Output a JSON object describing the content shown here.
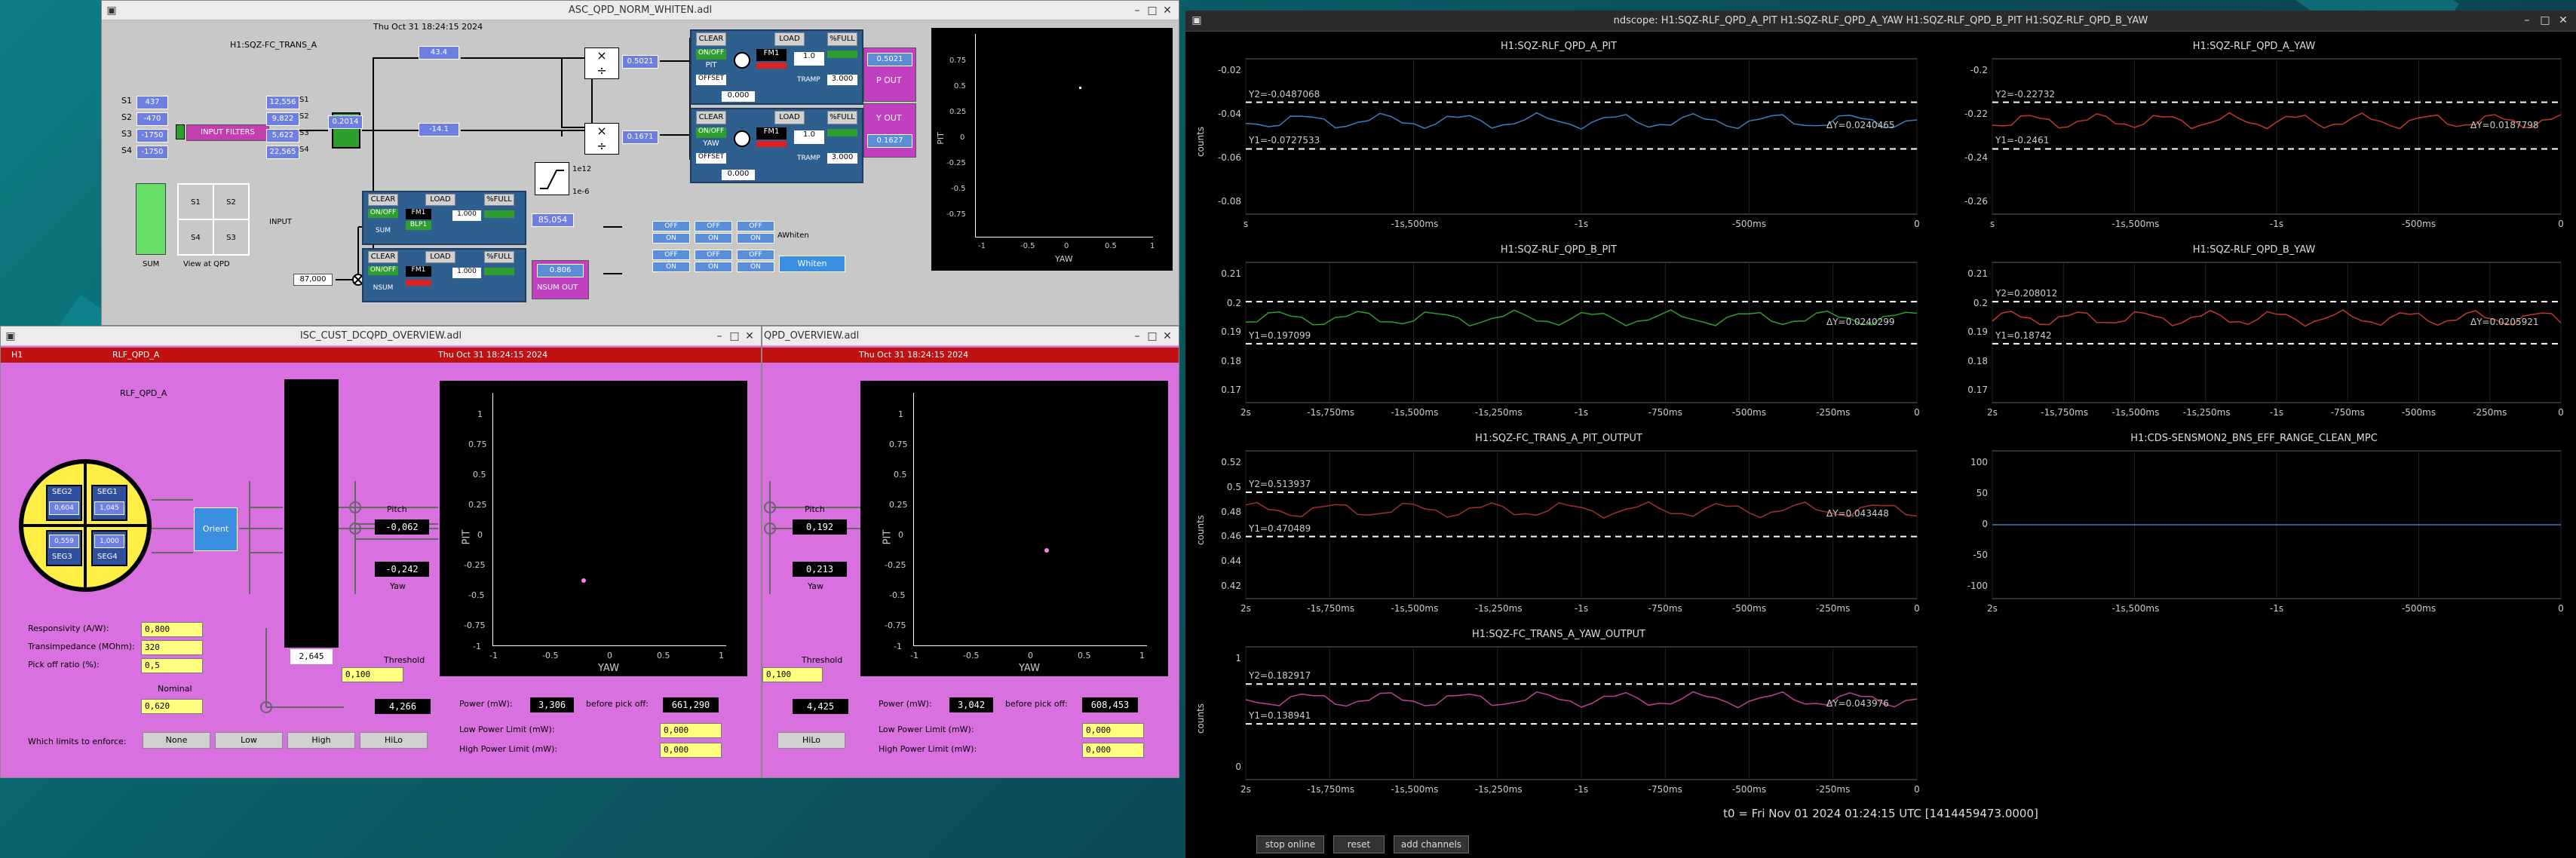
{
  "whiten_window": {
    "title": "ASC_QPD_NORM_WHITEN.adl",
    "channel": "H1:SQZ-FC_TRANS_A",
    "timestamp": "Thu Oct 31 18:24:15 2024",
    "segments": [
      "S1",
      "S2",
      "S3",
      "S4"
    ],
    "seg_values": [
      "437",
      "-470",
      "-1750",
      "-1750"
    ],
    "seg_out_values": [
      "12,556",
      "9,822",
      "5,622",
      "22,565"
    ],
    "input_filters": "INPUT FILTERS",
    "sum_value": "0.2014",
    "sum_label": "SUM",
    "view_label": "View at QPD",
    "quad_labels": [
      "S1",
      "S2",
      "S4",
      "S3"
    ],
    "input_label": "INPUT",
    "top_val": "43.4",
    "mid_val": "-14.1",
    "p_mult_val": "0.5021",
    "y_mult_val": "0.1671",
    "limit_a": "1e12",
    "limit_b": "1e-6",
    "pit_bank": {
      "clear": "CLEAR",
      "load": "LOAD",
      "full": "%FULL",
      "onoff": "ON/OFF",
      "name": "PIT",
      "fm1": "FM1",
      "offset": "OFFSET",
      "gain": "1.0",
      "offv": "0.000",
      "tramp": "TRAMP",
      "tramp_val": "3.000",
      "out_label": "P OUT",
      "out_val": "0.5021"
    },
    "yaw_bank": {
      "clear": "CLEAR",
      "load": "LOAD",
      "full": "%FULL",
      "onoff": "ON/OFF",
      "name": "YAW",
      "fm1": "FM1",
      "offset": "OFFSET",
      "gain": "1.0",
      "offv": "0.000",
      "tramp": "TRAMP",
      "tramp_val": "3.000",
      "out_label": "Y OUT",
      "out_val": "0.1627"
    },
    "sum_bank": {
      "clear": "CLEAR",
      "load": "LOAD",
      "full": "%FULL",
      "onoff": "ON/OFF",
      "name": "SUM",
      "fm1": "FM1",
      "val": "1.000",
      "filt": "BLP1",
      "out": "85,054"
    },
    "nsum_bank": {
      "clear": "CLEAR",
      "load": "LOAD",
      "full": "%FULL",
      "onoff": "ON/OFF",
      "name": "NSUM",
      "fm1": "FM1",
      "val": "1.000",
      "out": "0.806",
      "out_label": "NSUM OUT"
    },
    "nsum_in": "87,000",
    "whiten_label": "AWhiten",
    "whiten_btn": "Whiten",
    "off_labels": [
      "OFF",
      "OFF",
      "OFF",
      "OFF",
      "OFF",
      "OFF"
    ],
    "on_labels": [
      "ON",
      "ON",
      "ON",
      "ON",
      "ON",
      "ON"
    ],
    "scope": {
      "ylabel": "PIT",
      "xlabel": "YAW",
      "yticks": [
        "0.75",
        "0.5",
        "0.25",
        "0",
        "-0.25",
        "-0.5",
        "-0.75"
      ],
      "xticks": [
        "-1",
        "-0.5",
        "0",
        "0.5",
        "1"
      ]
    }
  },
  "overview_window": {
    "title": "ISC_CUST_DCQPD_OVERVIEW.adl",
    "header_left": "H1",
    "header_mid": "RLF_QPD_A",
    "timestamp": "Thu Oct 31 18:24:15 2024",
    "name": "RLF_QPD_A",
    "segs": [
      {
        "name": "SEG2",
        "val": "0,604"
      },
      {
        "name": "SEG1",
        "val": "1,045"
      },
      {
        "name": "SEG3",
        "val": "0,559"
      },
      {
        "name": "SEG4",
        "val": "1,000"
      }
    ],
    "seg_bottom": [
      "SEG3",
      "SEG4"
    ],
    "orient": "Orient",
    "bar_val": "2,645",
    "pitch_label": "Pitch",
    "pitch_val": "-0,062",
    "yaw_label": "Yaw",
    "yaw_val": "-0,242",
    "threshold_label": "Threshold",
    "threshold_val": "0,100",
    "nominal_label": "Nominal",
    "nominal_val": "0,620",
    "val_4266": "4,266",
    "resp_label": "Responsivity (A/W):",
    "resp_val": "0,800",
    "trans_label": "Transimpedance (MOhm):",
    "trans_val": "320",
    "pick_label": "Pick off ratio (%):",
    "pick_val": "0,5",
    "power_label": "Power (mW):",
    "power_val": "3,306",
    "before_label": "before pick off:",
    "before_val": "661,290",
    "lowlim_label": "Low Power Limit (mW):",
    "lowlim_val": "0,000",
    "highlim_label": "High Power Limit (mW):",
    "highlim_val": "0,000",
    "enforce_label": "Which limits to enforce:",
    "enforce_opts": [
      "None",
      "Low",
      "High",
      "HiLo"
    ],
    "scope": {
      "ylabel": "PIT",
      "xlabel": "YAW",
      "yticks": [
        "1",
        "0.75",
        "0.5",
        "0.25",
        "0",
        "-0.25",
        "-0.5",
        "-0.75",
        "-1"
      ],
      "xticks": [
        "-1",
        "-0.5",
        "0",
        "0.5",
        "1"
      ]
    }
  },
  "overview_b": {
    "title": "QPD_OVERVIEW.adl",
    "timestamp": "Thu Oct 31 18:24:15 2024",
    "pitch_label": "Pitch",
    "pitch_val": "0,192",
    "yaw_label": "Yaw",
    "yaw_val": "0,213",
    "threshold_label": "Threshold",
    "threshold_val": "0,100",
    "val_4425": "4,425",
    "hilo": "HiLo",
    "power_label": "Power (mW):",
    "power_val": "3,042",
    "before_label": "before pick off:",
    "before_val": "608,453",
    "lowlim_label": "Low Power Limit (mW):",
    "lowlim_val": "0,000",
    "highlim_label": "High Power Limit (mW):",
    "highlim_val": "0,000",
    "scope": {
      "ylabel": "PIT",
      "xlabel": "YAW",
      "yticks": [
        "1",
        "0.75",
        "0.5",
        "0.25",
        "0",
        "-0.25",
        "-0.5",
        "-0.75",
        "-1"
      ],
      "xticks": [
        "-1",
        "-0.5",
        "0",
        "0.5",
        "1"
      ]
    }
  },
  "ndscope": {
    "title": "ndscope: H1:SQZ-RLF_QPD_A_PIT H1:SQZ-RLF_QPD_A_YAW H1:SQZ-RLF_QPD_B_PIT H1:SQZ-RLF_QPD_B_YAW",
    "t0": "t0 = Fri Nov 01 2024 01:24:15 UTC [1414459473.0000]",
    "buttons": [
      "stop online",
      "reset",
      "add channels"
    ],
    "plots": [
      {
        "title": "H1:SQZ-RLF_QPD_A_PIT",
        "ylabel": "counts",
        "yticks": [
          "-0.02",
          "-0.04",
          "-0.06",
          "-0.08"
        ],
        "xticks": [
          "s",
          "-1s,500ms",
          "-1s",
          "-500ms",
          "0"
        ],
        "y2": "Y2=-0.0487068",
        "y1": "Y1=-0.0727533",
        "dy": "ΔY=0.0240465",
        "color": "#3a7fc0"
      },
      {
        "title": "H1:SQZ-RLF_QPD_A_YAW",
        "ylabel": "",
        "yticks": [
          "-0.2",
          "-0.22",
          "-0.24",
          "-0.26"
        ],
        "xticks": [
          "s",
          "-1s,500ms",
          "-1s",
          "-500ms",
          "0"
        ],
        "y2": "Y2=-0.22732",
        "y1": "Y1=-0.2461",
        "dy": "ΔY=0.0187798",
        "color": "#c0382b"
      },
      {
        "title": "H1:SQZ-RLF_QPD_B_PIT",
        "ylabel": "",
        "yticks": [
          "0.21",
          "0.2",
          "0.19",
          "0.18",
          "0.17"
        ],
        "xticks": [
          "2s",
          "-1s,750ms",
          "-1s,500ms",
          "-1s,250ms",
          "-1s",
          "-750ms",
          "-500ms",
          "-250ms",
          "0"
        ],
        "y2": "",
        "y1": "Y1=0.197099",
        "dy": "ΔY=0.0240299",
        "color": "#2e9e2e"
      },
      {
        "title": "H1:SQZ-RLF_QPD_B_YAW",
        "ylabel": "",
        "yticks": [
          "0.21",
          "0.2",
          "0.19",
          "0.18",
          "0.17"
        ],
        "xticks": [
          "2s",
          "-1s,750ms",
          "-1s,500ms",
          "-1s,250ms",
          "-1s",
          "-750ms",
          "-500ms",
          "-250ms",
          "0"
        ],
        "y2": "Y2=0.208012",
        "y1": "Y1=0.18742",
        "dy": "ΔY=0.0205921",
        "color": "#c0382b"
      },
      {
        "title": "H1:SQZ-FC_TRANS_A_PIT_OUTPUT",
        "ylabel": "counts",
        "yticks": [
          "0.52",
          "0.5",
          "0.48",
          "0.46",
          "0.44",
          "0.42"
        ],
        "xticks": [
          "2s",
          "-1s,750ms",
          "-1s,500ms",
          "-1s,250ms",
          "-1s",
          "-750ms",
          "-500ms",
          "-250ms",
          "0"
        ],
        "y2": "Y2=0.513937",
        "y1": "Y1=0.470489",
        "dy": "ΔY=0.043448",
        "color": "#a03030"
      },
      {
        "title": "H1:CDS-SENSMON2_BNS_EFF_RANGE_CLEAN_MPC",
        "ylabel": "",
        "yticks": [
          "100",
          "50",
          "0",
          "-50",
          "-100"
        ],
        "xticks": [
          "2s",
          "-1s,500ms",
          "-1s",
          "-500ms",
          "0"
        ],
        "y2": "",
        "y1": "",
        "dy": "",
        "color": "#3a7fc0"
      },
      {
        "title": "H1:SQZ-FC_TRANS_A_YAW_OUTPUT",
        "ylabel": "counts",
        "yticks": [
          "1",
          "",
          "",
          "0"
        ],
        "xticks": [
          "2s",
          "-1s,750ms",
          "-1s,500ms",
          "-1s,250ms",
          "-1s",
          "-750ms",
          "-500ms",
          "-250ms",
          "0"
        ],
        "y2": "Y2=0.182917",
        "y1": "Y1=0.138941",
        "dy": "ΔY=0.043976",
        "color": "#c04090"
      }
    ]
  }
}
